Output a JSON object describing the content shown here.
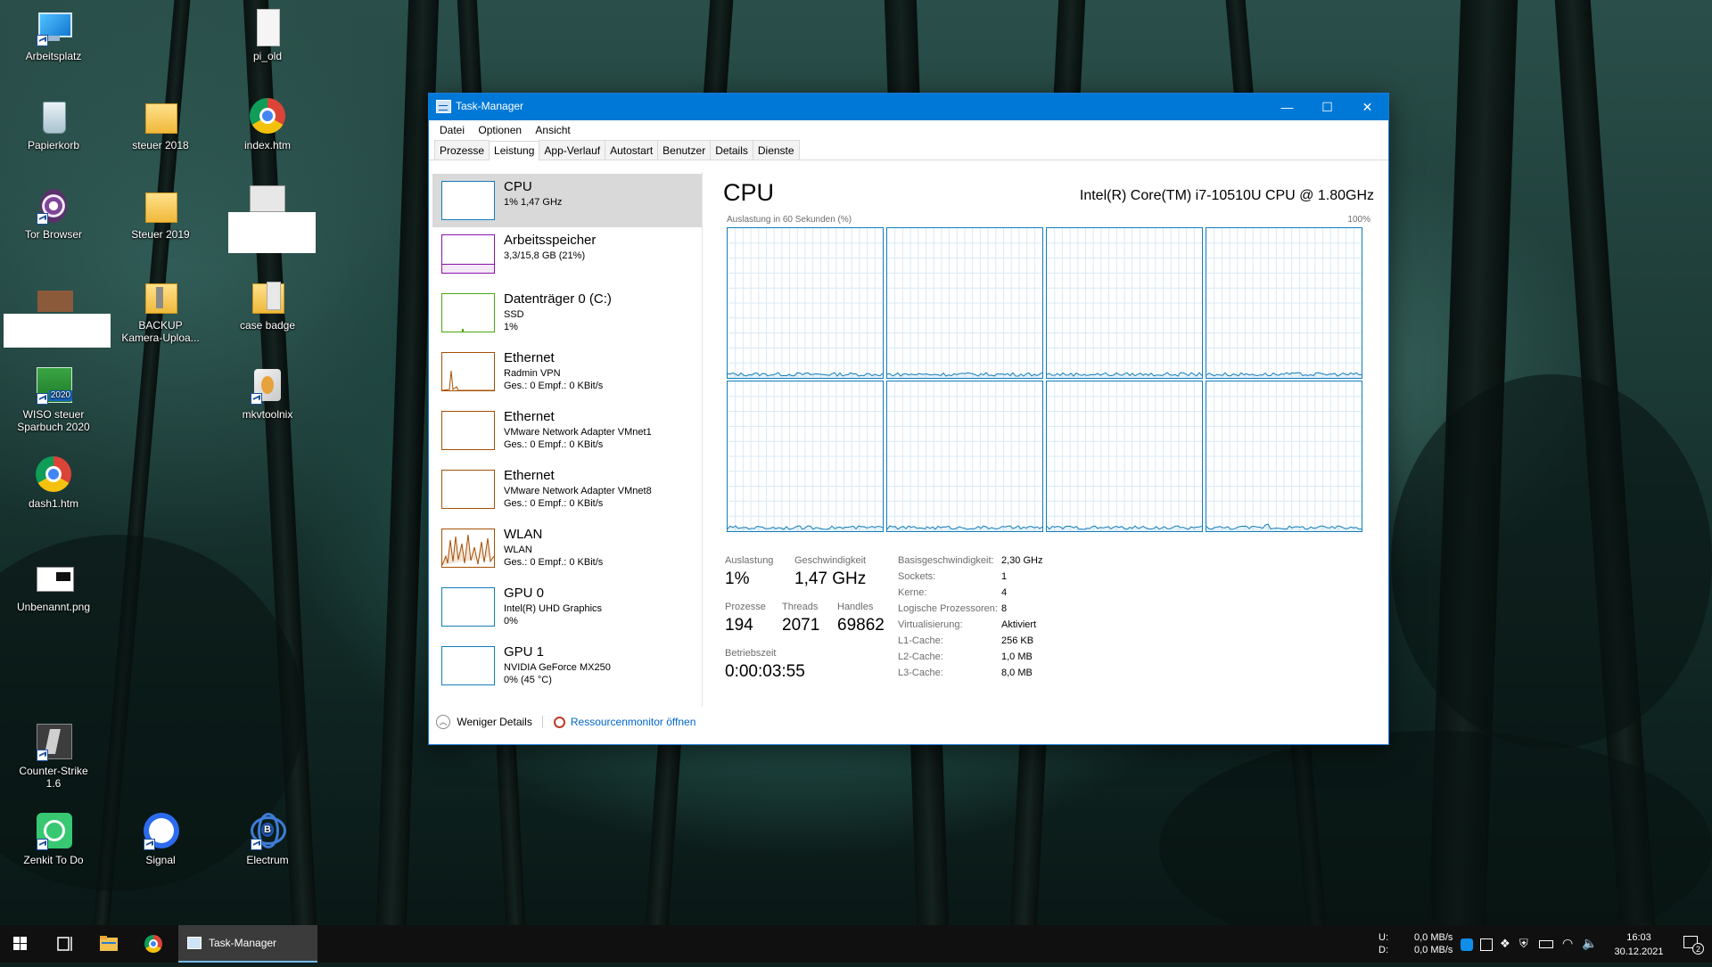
{
  "desktop": {
    "icons": [
      {
        "label": "Arbeitsplatz"
      },
      {
        "label": "pi_old"
      },
      {
        "label": "Papierkorb"
      },
      {
        "label": "steuer 2018"
      },
      {
        "label": "index.htm"
      },
      {
        "label": "Tor Browser"
      },
      {
        "label": "Steuer 2019"
      },
      {
        "label": "BACKUP Kamera-Uploa..."
      },
      {
        "label": "case badge"
      },
      {
        "label": "WISO steuer Sparbuch 2020"
      },
      {
        "label": "mkvtoolnix"
      },
      {
        "label": "dash1.htm"
      },
      {
        "label": "Unbenannt.png"
      },
      {
        "label": "Counter-Strike 1.6"
      },
      {
        "label": "Zenkit To Do"
      },
      {
        "label": "Signal"
      },
      {
        "label": "Electrum"
      }
    ],
    "wiso_badge": "2020"
  },
  "window": {
    "title": "Task-Manager",
    "menu": [
      "Datei",
      "Optionen",
      "Ansicht"
    ],
    "tabs": [
      "Prozesse",
      "Leistung",
      "App-Verlauf",
      "Autostart",
      "Benutzer",
      "Details",
      "Dienste"
    ],
    "active_tab": "Leistung",
    "controls": {
      "minimize": "—",
      "maximize": "☐",
      "close": "✕"
    }
  },
  "resources": [
    {
      "name": "CPU",
      "line2": "1% 1,47 GHz",
      "line3": "",
      "color": "#117dbb"
    },
    {
      "name": "Arbeitsspeicher",
      "line2": "3,3/15,8 GB (21%)",
      "line3": "",
      "color": "#8b12ae"
    },
    {
      "name": "Datenträger 0 (C:)",
      "line2": "SSD",
      "line3": "1%",
      "color": "#4da60c"
    },
    {
      "name": "Ethernet",
      "line2": "Radmin VPN",
      "line3": "Ges.: 0 Empf.: 0 KBit/s",
      "color": "#a74f01"
    },
    {
      "name": "Ethernet",
      "line2": "VMware Network Adapter VMnet1",
      "line3": "Ges.: 0 Empf.: 0 KBit/s",
      "color": "#a74f01"
    },
    {
      "name": "Ethernet",
      "line2": "VMware Network Adapter VMnet8",
      "line3": "Ges.: 0 Empf.: 0 KBit/s",
      "color": "#a74f01"
    },
    {
      "name": "WLAN",
      "line2": "WLAN",
      "line3": "Ges.: 0 Empf.: 0 KBit/s",
      "color": "#a74f01"
    },
    {
      "name": "GPU 0",
      "line2": "Intel(R) UHD Graphics",
      "line3": "0%",
      "color": "#117dbb"
    },
    {
      "name": "GPU 1",
      "line2": "NVIDIA GeForce MX250",
      "line3": "0% (45 °C)",
      "color": "#117dbb"
    }
  ],
  "cpu": {
    "title": "CPU",
    "model": "Intel(R) Core(TM) i7-10510U CPU @ 1.80GHz",
    "graph_label": "Auslastung in 60 Sekunden (%)",
    "graph_max": "100%",
    "stats": {
      "util_label": "Auslastung",
      "util": "1%",
      "speed_label": "Geschwindigkeit",
      "speed": "1,47 GHz",
      "proc_label": "Prozesse",
      "proc": "194",
      "threads_label": "Threads",
      "threads": "2071",
      "handles_label": "Handles",
      "handles": "69862",
      "uptime_label": "Betriebszeit",
      "uptime": "0:00:03:55"
    },
    "details": [
      {
        "k": "Basisgeschwindigkeit:",
        "v": "2,30 GHz"
      },
      {
        "k": "Sockets:",
        "v": "1"
      },
      {
        "k": "Kerne:",
        "v": "4"
      },
      {
        "k": "Logische Prozessoren:",
        "v": "8"
      },
      {
        "k": "Virtualisierung:",
        "v": "Aktiviert"
      },
      {
        "k": "L1-Cache:",
        "v": "256 KB"
      },
      {
        "k": "L2-Cache:",
        "v": "1,0 MB"
      },
      {
        "k": "L3-Cache:",
        "v": "8,0 MB"
      }
    ]
  },
  "footer": {
    "less": "Weniger Details",
    "monitor": "Ressourcenmonitor öffnen"
  },
  "taskbar": {
    "app_label": "Task-Manager",
    "net_u_label": "U:",
    "net_d_label": "D:",
    "net_u": "0,0 MB/s",
    "net_d": "0,0 MB/s",
    "time": "16:03",
    "date": "30.12.2021",
    "notif_count": "2"
  }
}
